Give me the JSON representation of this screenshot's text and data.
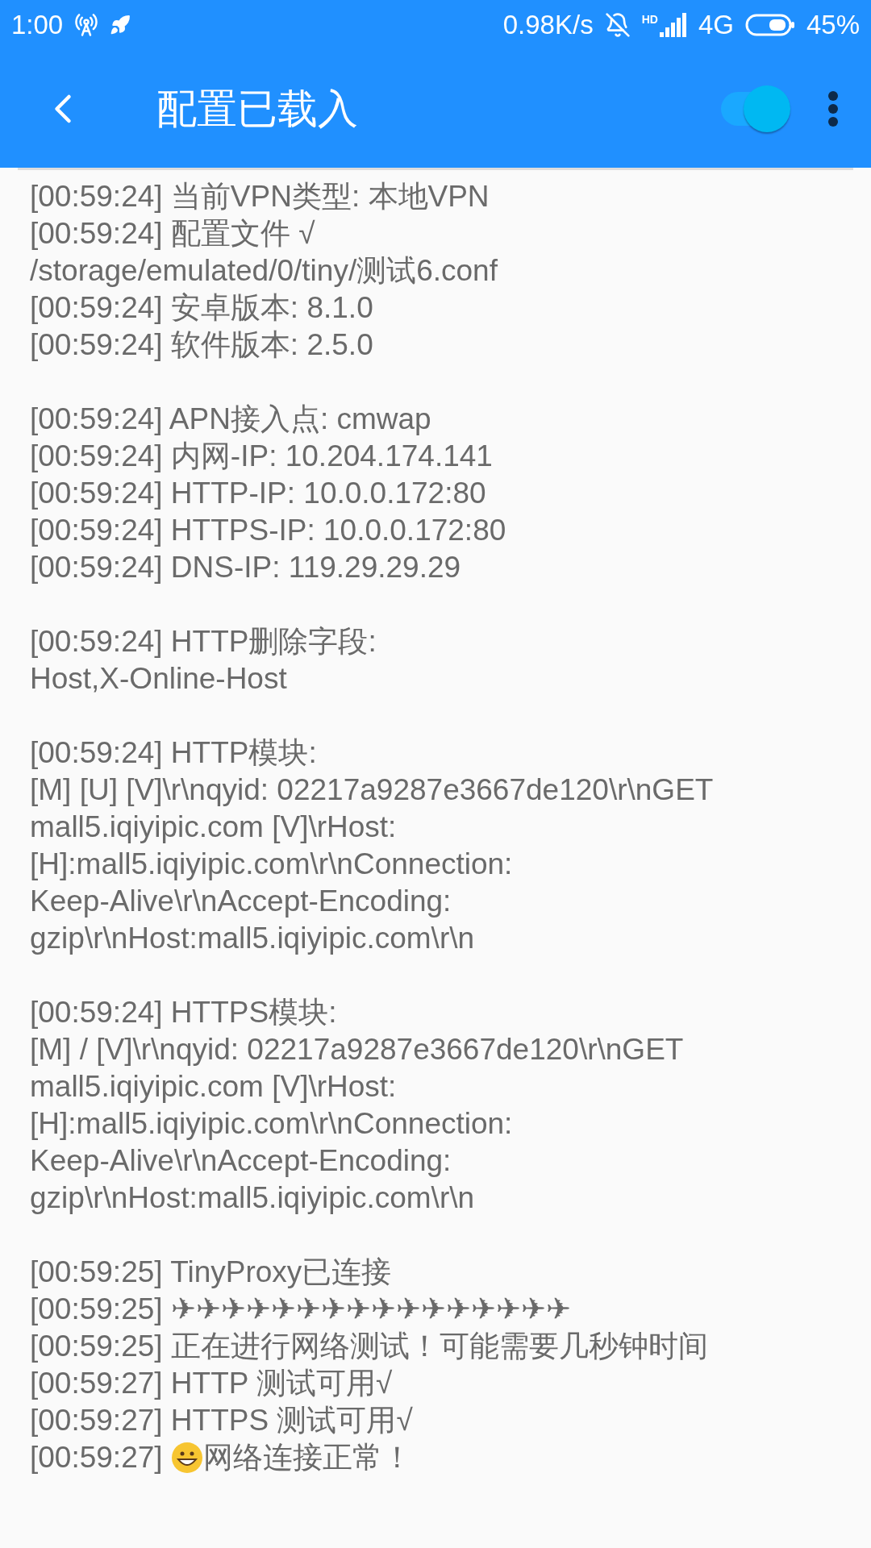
{
  "status_bar": {
    "time": "1:00",
    "speed": "0.98K/s",
    "hd_label": "HD",
    "network": "4G",
    "battery": "45%"
  },
  "header": {
    "title": "配置已载入",
    "switch": {
      "on": true
    }
  },
  "log": [
    [
      {
        "text": "[00:59:24] 当前VPN类型: 本地VPN"
      },
      {
        "text": "[00:59:24] 配置文件 √"
      },
      {
        "text": "/storage/emulated/0/tiny/测试6.conf"
      },
      {
        "text": "[00:59:24] 安卓版本: 8.1.0"
      },
      {
        "text": "[00:59:24] 软件版本: 2.5.0"
      }
    ],
    [
      {
        "text": "[00:59:24] APN接入点: cmwap"
      },
      {
        "text": "[00:59:24] 内网-IP: 10.204.174.141"
      },
      {
        "text": "[00:59:24] HTTP-IP: 10.0.0.172:80"
      },
      {
        "text": "[00:59:24] HTTPS-IP: 10.0.0.172:80"
      },
      {
        "text": "[00:59:24] DNS-IP: 119.29.29.29"
      }
    ],
    [
      {
        "text": "[00:59:24] HTTP删除字段:"
      },
      {
        "text": "Host,X-Online-Host"
      }
    ],
    [
      {
        "text": "[00:59:24] HTTP模块:"
      },
      {
        "text": "[M] [U] [V]\\r\\nqyid: 02217a9287e3667de120\\r\\nGET"
      },
      {
        "text": "mall5.iqiyipic.com [V]\\rHost:"
      },
      {
        "text": "[H]:mall5.iqiyipic.com\\r\\nConnection:"
      },
      {
        "text": "Keep-Alive\\r\\nAccept-Encoding:"
      },
      {
        "text": "gzip\\r\\nHost:mall5.iqiyipic.com\\r\\n"
      }
    ],
    [
      {
        "text": "[00:59:24] HTTPS模块:"
      },
      {
        "text": "[M] / [V]\\r\\nqyid: 02217a9287e3667de120\\r\\nGET"
      },
      {
        "text": "mall5.iqiyipic.com [V]\\rHost:"
      },
      {
        "text": "[H]:mall5.iqiyipic.com\\r\\nConnection:"
      },
      {
        "text": "Keep-Alive\\r\\nAccept-Encoding:"
      },
      {
        "text": "gzip\\r\\nHost:mall5.iqiyipic.com\\r\\n"
      }
    ],
    [
      {
        "text": "[00:59:25] TinyProxy已连接"
      },
      {
        "text": "[00:59:25] ✈✈✈✈✈✈✈✈✈✈✈✈✈✈✈✈"
      },
      {
        "text": "[00:59:25] 正在进行网络测试！可能需要几秒钟时间"
      },
      {
        "text": "[00:59:27] HTTP 测试可用√"
      },
      {
        "text": "[00:59:27] HTTPS 测试可用√"
      },
      {
        "kind": "emoji",
        "text": "[00:59:27]",
        "after": "网络连接正常！"
      }
    ]
  ]
}
